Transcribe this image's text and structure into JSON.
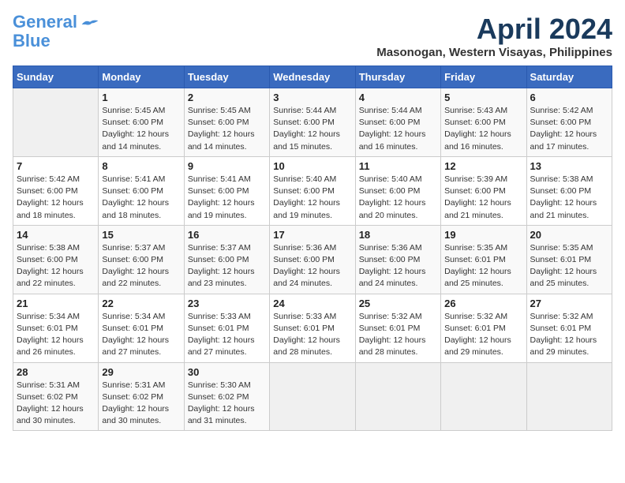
{
  "header": {
    "logo_line1": "General",
    "logo_line2": "Blue",
    "month_title": "April 2024",
    "subtitle": "Masonogan, Western Visayas, Philippines"
  },
  "days_of_week": [
    "Sunday",
    "Monday",
    "Tuesday",
    "Wednesday",
    "Thursday",
    "Friday",
    "Saturday"
  ],
  "weeks": [
    [
      {
        "num": "",
        "info": ""
      },
      {
        "num": "1",
        "info": "Sunrise: 5:45 AM\nSunset: 6:00 PM\nDaylight: 12 hours\nand 14 minutes."
      },
      {
        "num": "2",
        "info": "Sunrise: 5:45 AM\nSunset: 6:00 PM\nDaylight: 12 hours\nand 14 minutes."
      },
      {
        "num": "3",
        "info": "Sunrise: 5:44 AM\nSunset: 6:00 PM\nDaylight: 12 hours\nand 15 minutes."
      },
      {
        "num": "4",
        "info": "Sunrise: 5:44 AM\nSunset: 6:00 PM\nDaylight: 12 hours\nand 16 minutes."
      },
      {
        "num": "5",
        "info": "Sunrise: 5:43 AM\nSunset: 6:00 PM\nDaylight: 12 hours\nand 16 minutes."
      },
      {
        "num": "6",
        "info": "Sunrise: 5:42 AM\nSunset: 6:00 PM\nDaylight: 12 hours\nand 17 minutes."
      }
    ],
    [
      {
        "num": "7",
        "info": "Sunrise: 5:42 AM\nSunset: 6:00 PM\nDaylight: 12 hours\nand 18 minutes."
      },
      {
        "num": "8",
        "info": "Sunrise: 5:41 AM\nSunset: 6:00 PM\nDaylight: 12 hours\nand 18 minutes."
      },
      {
        "num": "9",
        "info": "Sunrise: 5:41 AM\nSunset: 6:00 PM\nDaylight: 12 hours\nand 19 minutes."
      },
      {
        "num": "10",
        "info": "Sunrise: 5:40 AM\nSunset: 6:00 PM\nDaylight: 12 hours\nand 19 minutes."
      },
      {
        "num": "11",
        "info": "Sunrise: 5:40 AM\nSunset: 6:00 PM\nDaylight: 12 hours\nand 20 minutes."
      },
      {
        "num": "12",
        "info": "Sunrise: 5:39 AM\nSunset: 6:00 PM\nDaylight: 12 hours\nand 21 minutes."
      },
      {
        "num": "13",
        "info": "Sunrise: 5:38 AM\nSunset: 6:00 PM\nDaylight: 12 hours\nand 21 minutes."
      }
    ],
    [
      {
        "num": "14",
        "info": "Sunrise: 5:38 AM\nSunset: 6:00 PM\nDaylight: 12 hours\nand 22 minutes."
      },
      {
        "num": "15",
        "info": "Sunrise: 5:37 AM\nSunset: 6:00 PM\nDaylight: 12 hours\nand 22 minutes."
      },
      {
        "num": "16",
        "info": "Sunrise: 5:37 AM\nSunset: 6:00 PM\nDaylight: 12 hours\nand 23 minutes."
      },
      {
        "num": "17",
        "info": "Sunrise: 5:36 AM\nSunset: 6:00 PM\nDaylight: 12 hours\nand 24 minutes."
      },
      {
        "num": "18",
        "info": "Sunrise: 5:36 AM\nSunset: 6:00 PM\nDaylight: 12 hours\nand 24 minutes."
      },
      {
        "num": "19",
        "info": "Sunrise: 5:35 AM\nSunset: 6:01 PM\nDaylight: 12 hours\nand 25 minutes."
      },
      {
        "num": "20",
        "info": "Sunrise: 5:35 AM\nSunset: 6:01 PM\nDaylight: 12 hours\nand 25 minutes."
      }
    ],
    [
      {
        "num": "21",
        "info": "Sunrise: 5:34 AM\nSunset: 6:01 PM\nDaylight: 12 hours\nand 26 minutes."
      },
      {
        "num": "22",
        "info": "Sunrise: 5:34 AM\nSunset: 6:01 PM\nDaylight: 12 hours\nand 27 minutes."
      },
      {
        "num": "23",
        "info": "Sunrise: 5:33 AM\nSunset: 6:01 PM\nDaylight: 12 hours\nand 27 minutes."
      },
      {
        "num": "24",
        "info": "Sunrise: 5:33 AM\nSunset: 6:01 PM\nDaylight: 12 hours\nand 28 minutes."
      },
      {
        "num": "25",
        "info": "Sunrise: 5:32 AM\nSunset: 6:01 PM\nDaylight: 12 hours\nand 28 minutes."
      },
      {
        "num": "26",
        "info": "Sunrise: 5:32 AM\nSunset: 6:01 PM\nDaylight: 12 hours\nand 29 minutes."
      },
      {
        "num": "27",
        "info": "Sunrise: 5:32 AM\nSunset: 6:01 PM\nDaylight: 12 hours\nand 29 minutes."
      }
    ],
    [
      {
        "num": "28",
        "info": "Sunrise: 5:31 AM\nSunset: 6:02 PM\nDaylight: 12 hours\nand 30 minutes."
      },
      {
        "num": "29",
        "info": "Sunrise: 5:31 AM\nSunset: 6:02 PM\nDaylight: 12 hours\nand 30 minutes."
      },
      {
        "num": "30",
        "info": "Sunrise: 5:30 AM\nSunset: 6:02 PM\nDaylight: 12 hours\nand 31 minutes."
      },
      {
        "num": "",
        "info": ""
      },
      {
        "num": "",
        "info": ""
      },
      {
        "num": "",
        "info": ""
      },
      {
        "num": "",
        "info": ""
      }
    ]
  ]
}
